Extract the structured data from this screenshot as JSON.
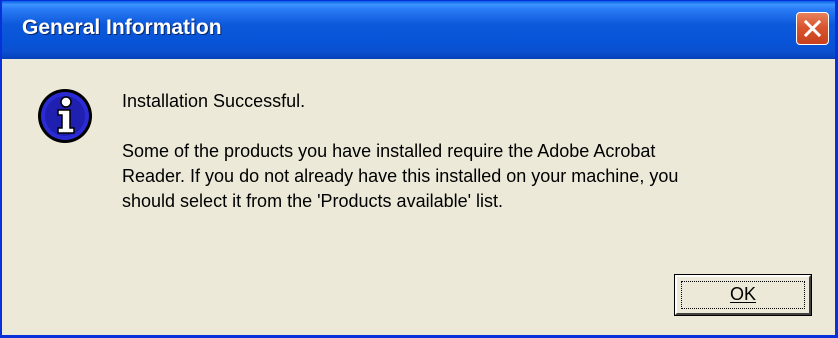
{
  "window": {
    "title": "General Information"
  },
  "message": {
    "line1": "Installation Successful.",
    "line2": "Some of the products you have installed require the Adobe Acrobat\nReader.  If you do not already have this installed on your machine, you\nshould select it from the 'Products available' list."
  },
  "buttons": {
    "ok_label": "OK"
  },
  "icons": {
    "info": "info-icon",
    "close": "close-icon"
  },
  "colors": {
    "titlebar": "#0a54d8",
    "dialog_background": "#ece9d8",
    "close_button": "#d9552f"
  }
}
